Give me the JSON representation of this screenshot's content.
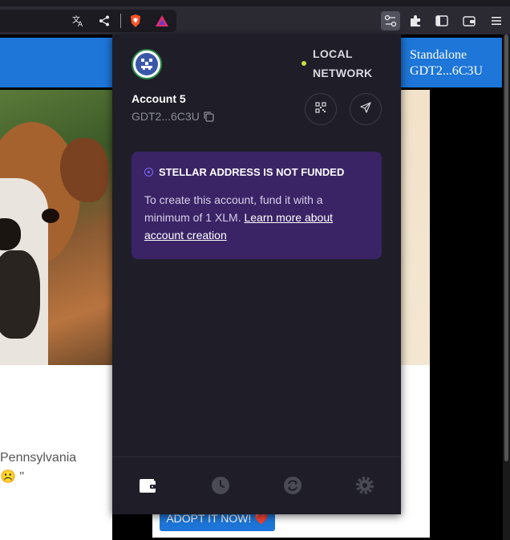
{
  "browser": {
    "translate_icon": "translate-icon",
    "share_icon": "share-icon",
    "brave_icon": "brave-shield-icon",
    "rewards_icon": "brave-rewards-icon",
    "extension_icons": [
      "wallet-extension-icon",
      "puzzle-icon",
      "sidebar-icon",
      "wallet-icon",
      "menu-icon"
    ]
  },
  "page": {
    "right_header_line1": "Standalone",
    "right_header_line2": "GDT2...6C3U",
    "snippet_line1": "Pennsylvania",
    "snippet_line2": "☹️ \"",
    "adopt_button": "ADOPT IT NOW! ❤️"
  },
  "popup": {
    "network": {
      "label": "LOCAL NETWORK",
      "status_color": "#c4e34a"
    },
    "account": {
      "name": "Account 5",
      "short_address": "GDT2...6C3U"
    },
    "actions": {
      "qr_icon": "qr-code-icon",
      "send_icon": "send-icon"
    },
    "notice": {
      "title": "STELLAR ADDRESS IS NOT FUNDED",
      "body": "To create this account, fund it with a minimum of 1 XLM.",
      "link": "Learn more about account creation"
    },
    "nav": [
      {
        "name": "wallet-icon",
        "active": true
      },
      {
        "name": "history-icon",
        "active": false
      },
      {
        "name": "swap-icon",
        "active": false
      },
      {
        "name": "settings-icon",
        "active": false
      }
    ]
  },
  "colors": {
    "popup_bg": "#1f1e28",
    "notice_bg": "#3a2466",
    "accent_blue": "#1d76d8"
  }
}
